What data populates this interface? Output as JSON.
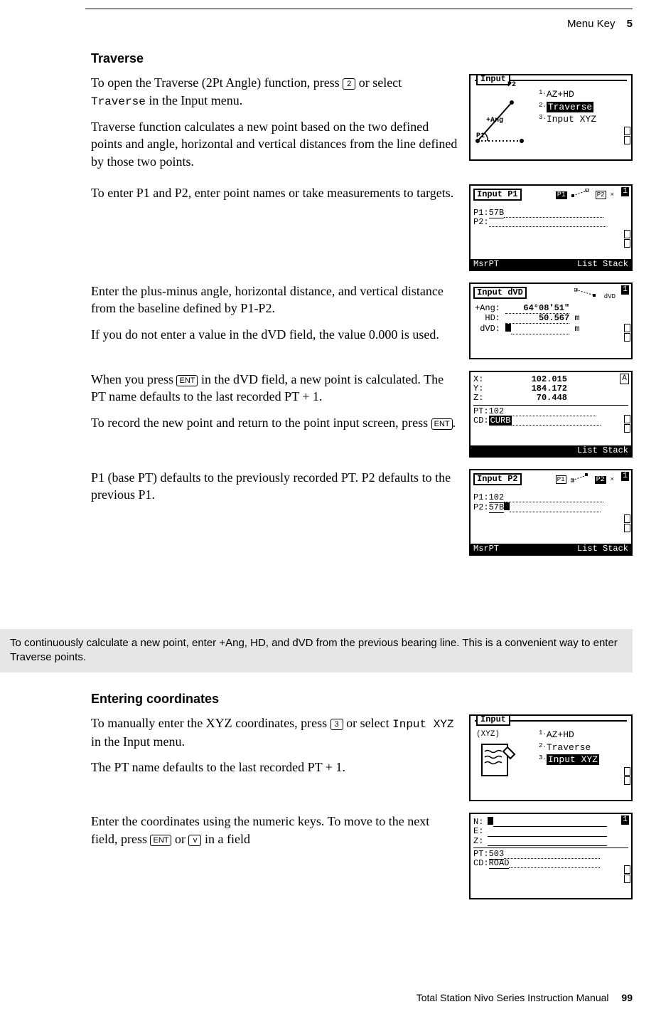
{
  "header": {
    "section": "Menu Key",
    "chapter": "5"
  },
  "footer": {
    "manual": "Total Station Nivo Series Instruction Manual",
    "page": "99"
  },
  "h_traverse": "Traverse",
  "p1a": "To open the Traverse (2Pt Angle) function, press ",
  "p1b": " or select ",
  "p1c": " in the Input menu.",
  "p1_key": "2",
  "p1_mono": "Traverse",
  "p2": "Traverse function calculates a new point based on the two defined points and angle, horizontal and vertical distances from the line defined by those two points.",
  "p3": "To enter P1 and P2, enter point names or take measurements to targets.",
  "p4": "Enter the plus-minus angle, horizontal distance, and vertical distance from the baseline defined by P1-P2.",
  "p5": "If you do not enter a value in the dVD field, the value 0.000 is used.",
  "p6a": "When you press ",
  "p6b": " in the dVD field, a new point is calculated. The PT name defaults to the last recorded PT + 1.",
  "p6_key": "ENT",
  "p7a": "To record the new point and return to the point input screen, press ",
  "p7b": ".",
  "p7_key": "ENT",
  "p8": "P1 (base PT) defaults to the previously recorded PT. P2 defaults to the previous P1.",
  "note": "To continuously calculate a new point, enter +Ang, HD, and dVD from the previous bearing line. This is a convenient way to enter Traverse points.",
  "h_coords": "Entering coordinates",
  "c1a": "To manually enter the XYZ coordinates, press ",
  "c1b": " or select ",
  "c1c": " in the Input menu.",
  "c1_key": "3",
  "c1_mono": "Input XYZ",
  "c2": "The PT name defaults to the last recorded PT + 1.",
  "c3a": "Enter the coordinates using the numeric keys. To move to the next field, press ",
  "c3b": " or ",
  "c3c": " in a field",
  "c3_key1": "ENT",
  "c3_key2": "v",
  "scr1": {
    "title": "Input",
    "menu1": "AZ+HD",
    "menu2": "Traverse",
    "menu3": "Input XYZ",
    "p1": "P1",
    "p2": "P2",
    "ang": "+Ang"
  },
  "scr2": {
    "title": "Input P1",
    "p1label": "P1:",
    "p1val": "57B",
    "p2label": "P2:",
    "sk_left": "MsrPT",
    "sk_right": "List Stack",
    "badge_p1": "P1",
    "badge_p2": "P2"
  },
  "scr3": {
    "title": "Input dVD",
    "l1": "+Ang:",
    "v1": "64°08'51\"",
    "l2": "HD:",
    "v2": "50.567",
    "u2": "m",
    "l3": "dVD:",
    "u3": "m",
    "tag": "dVD"
  },
  "scr4": {
    "x": "X:",
    "xv": "102.015",
    "y": "Y:",
    "yv": "184.172",
    "z": "Z:",
    "zv": "70.448",
    "pt": "PT:",
    "ptv": "102",
    "cd": "CD:",
    "cdv": "CURB",
    "sk_right": "List Stack",
    "badge": "A"
  },
  "scr5": {
    "title": "Input P2",
    "p1label": "P1:",
    "p1val": "102",
    "p2label": "P2:",
    "p2val": "57B",
    "sk_left": "MsrPT",
    "sk_right": "List Stack",
    "badge_p1": "P1",
    "badge_p2": "P2"
  },
  "scr6": {
    "title": "Input",
    "xyz": "(XYZ)",
    "menu1": "AZ+HD",
    "menu2": "Traverse",
    "menu3": "Input XYZ"
  },
  "scr7": {
    "n": "N:",
    "e": "E:",
    "z": "Z:",
    "pt": "PT:",
    "ptv": "503",
    "cd": "CD:",
    "cdv": "ROAD"
  }
}
